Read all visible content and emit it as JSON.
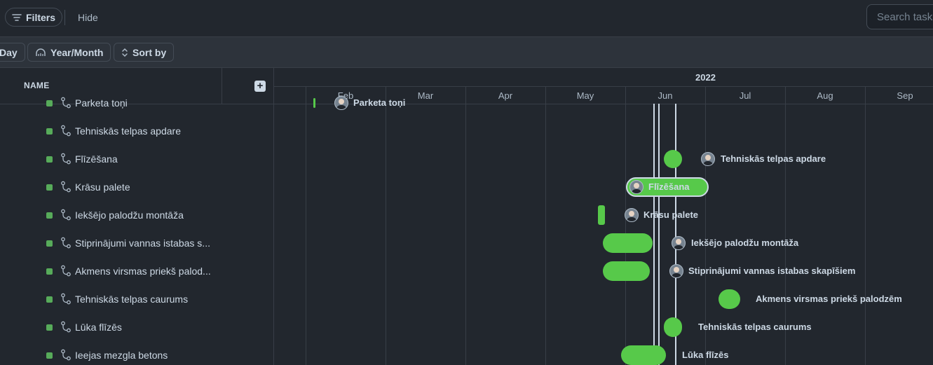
{
  "toolbar_top": {
    "filters_label": "Filters",
    "hide_label": "Hide",
    "search_placeholder": "Search tasks"
  },
  "toolbar_view": {
    "day_label": "Day",
    "yearmonth_label": "Year/Month",
    "sortby_label": "Sort by"
  },
  "list": {
    "header": "NAME",
    "add_icon": "plus-square-icon",
    "rows": [
      {
        "name": "Parketa toņi"
      },
      {
        "name": "Tehniskās telpas apdare"
      },
      {
        "name": "Flīzēšana"
      },
      {
        "name": "Krāsu palete"
      },
      {
        "name": "Iekšējo palodžu montāža"
      },
      {
        "name": "Stiprinājumi vannas istabas s..."
      },
      {
        "name": "Akmens virsmas priekš palod..."
      },
      {
        "name": "Tehniskās telpas caurums"
      },
      {
        "name": "Lūka flīzēs"
      },
      {
        "name": "Ieejas mezgla betons"
      }
    ]
  },
  "timeline": {
    "year": "2022",
    "months": [
      "Feb",
      "Mar",
      "Apr",
      "May",
      "Jun",
      "Jul",
      "Aug",
      "Sep"
    ],
    "bar_color": "#57c94a",
    "tasks": [
      {
        "label": "Parketa toņi"
      },
      {
        "label": "Tehniskās telpas apdare"
      },
      {
        "label": "Flīzēšana"
      },
      {
        "label": "Krāsu palete"
      },
      {
        "label": "Iekšējo palodžu montāža"
      },
      {
        "label": "Stiprinājumi vannas istabas skapīšiem"
      },
      {
        "label": "Akmens virsmas priekš palodzēm"
      },
      {
        "label": "Tehniskās telpas caurums"
      },
      {
        "label": "Lūka flīzēs"
      }
    ]
  }
}
